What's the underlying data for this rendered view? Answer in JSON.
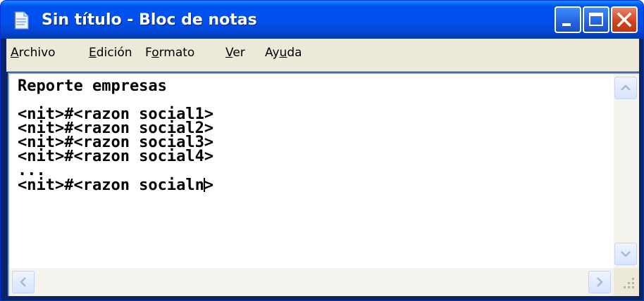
{
  "window": {
    "title": "Sin título - Bloc de notas"
  },
  "icons": {
    "app": "notepad-icon",
    "minimize": "minimize-icon",
    "maximize": "maximize-icon",
    "close": "close-icon",
    "scroll_up": "arrow-up-icon",
    "scroll_down": "arrow-down-icon",
    "scroll_left": "arrow-left-icon",
    "scroll_right": "arrow-right-icon",
    "resize_grip": "resize-grip-icon"
  },
  "menu": {
    "archivo": {
      "hotkey": "A",
      "rest": "rchivo"
    },
    "edicion": {
      "hotkey": "E",
      "rest": "dición"
    },
    "formato": {
      "pre": "F",
      "hotkey": "o",
      "rest": "rmato"
    },
    "ver": {
      "hotkey": "V",
      "rest": "er"
    },
    "ayuda": {
      "pre": "Ay",
      "hotkey": "u",
      "rest": "da"
    }
  },
  "editor": {
    "lines": [
      "Reporte empresas",
      "",
      "<nit>#<razon social1>",
      "<nit>#<razon social2>",
      "<nit>#<razon social3>",
      "<nit>#<razon social4>",
      "..."
    ],
    "last_line_before_caret": "<nit>#<razon socialn",
    "last_line_after_caret": ">"
  },
  "colors": {
    "titlebar": "#0053ee",
    "frame": "#0a246a",
    "menubar": "#ece9d8",
    "close_button": "#d3431e"
  }
}
